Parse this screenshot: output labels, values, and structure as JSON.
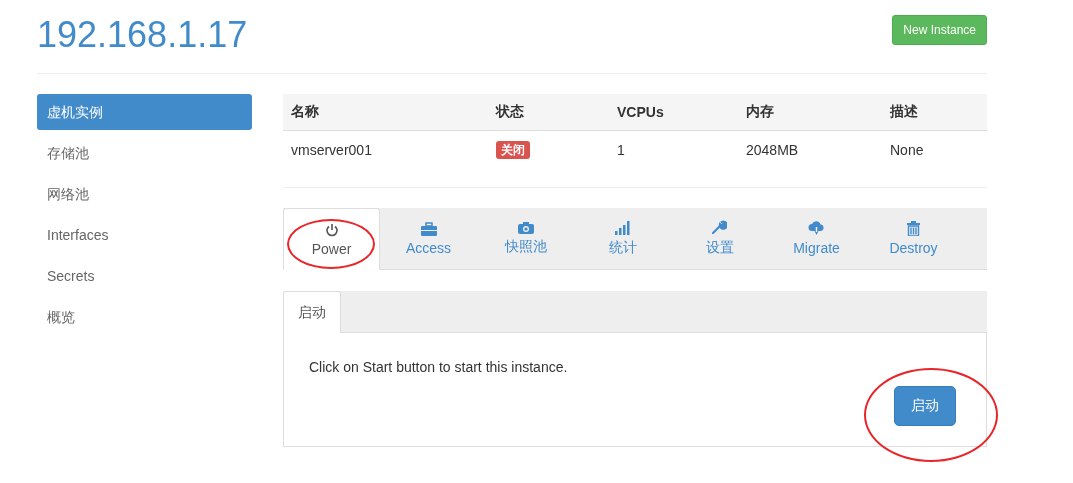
{
  "header": {
    "title": "192.168.1.17",
    "button": "New Instance"
  },
  "sidebar": {
    "items": [
      {
        "label": "虚机实例",
        "selected": true
      },
      {
        "label": "存储池",
        "selected": false
      },
      {
        "label": "网络池",
        "selected": false
      },
      {
        "label": "Interfaces",
        "selected": false
      },
      {
        "label": "Secrets",
        "selected": false
      },
      {
        "label": "概览",
        "selected": false
      }
    ]
  },
  "table": {
    "columns": [
      "名称",
      "状态",
      "VCPUs",
      "内存",
      "描述"
    ],
    "rows": [
      {
        "name": "vmserver001",
        "status": "关闭",
        "vcpus": "1",
        "memory": "2048MB",
        "description": "None"
      }
    ]
  },
  "tabs": [
    {
      "label": "Power",
      "kind": "power",
      "selected": true,
      "circled": true
    },
    {
      "label": "Access",
      "kind": "briefcase",
      "selected": false,
      "circled": false
    },
    {
      "label": "快照池",
      "kind": "camera",
      "selected": false,
      "circled": false
    },
    {
      "label": "统计",
      "kind": "signal",
      "selected": false,
      "circled": false
    },
    {
      "label": "设置",
      "kind": "wrench",
      "selected": false,
      "circled": false
    },
    {
      "label": "Migrate",
      "kind": "cloud",
      "selected": false,
      "circled": false
    },
    {
      "label": "Destroy",
      "kind": "trash",
      "selected": false,
      "circled": false
    }
  ],
  "subtabs": [
    {
      "label": "启动",
      "selected": true
    }
  ],
  "panel": {
    "message": "Click on Start button to start this instance.",
    "button": "启动",
    "button_circled": true
  }
}
